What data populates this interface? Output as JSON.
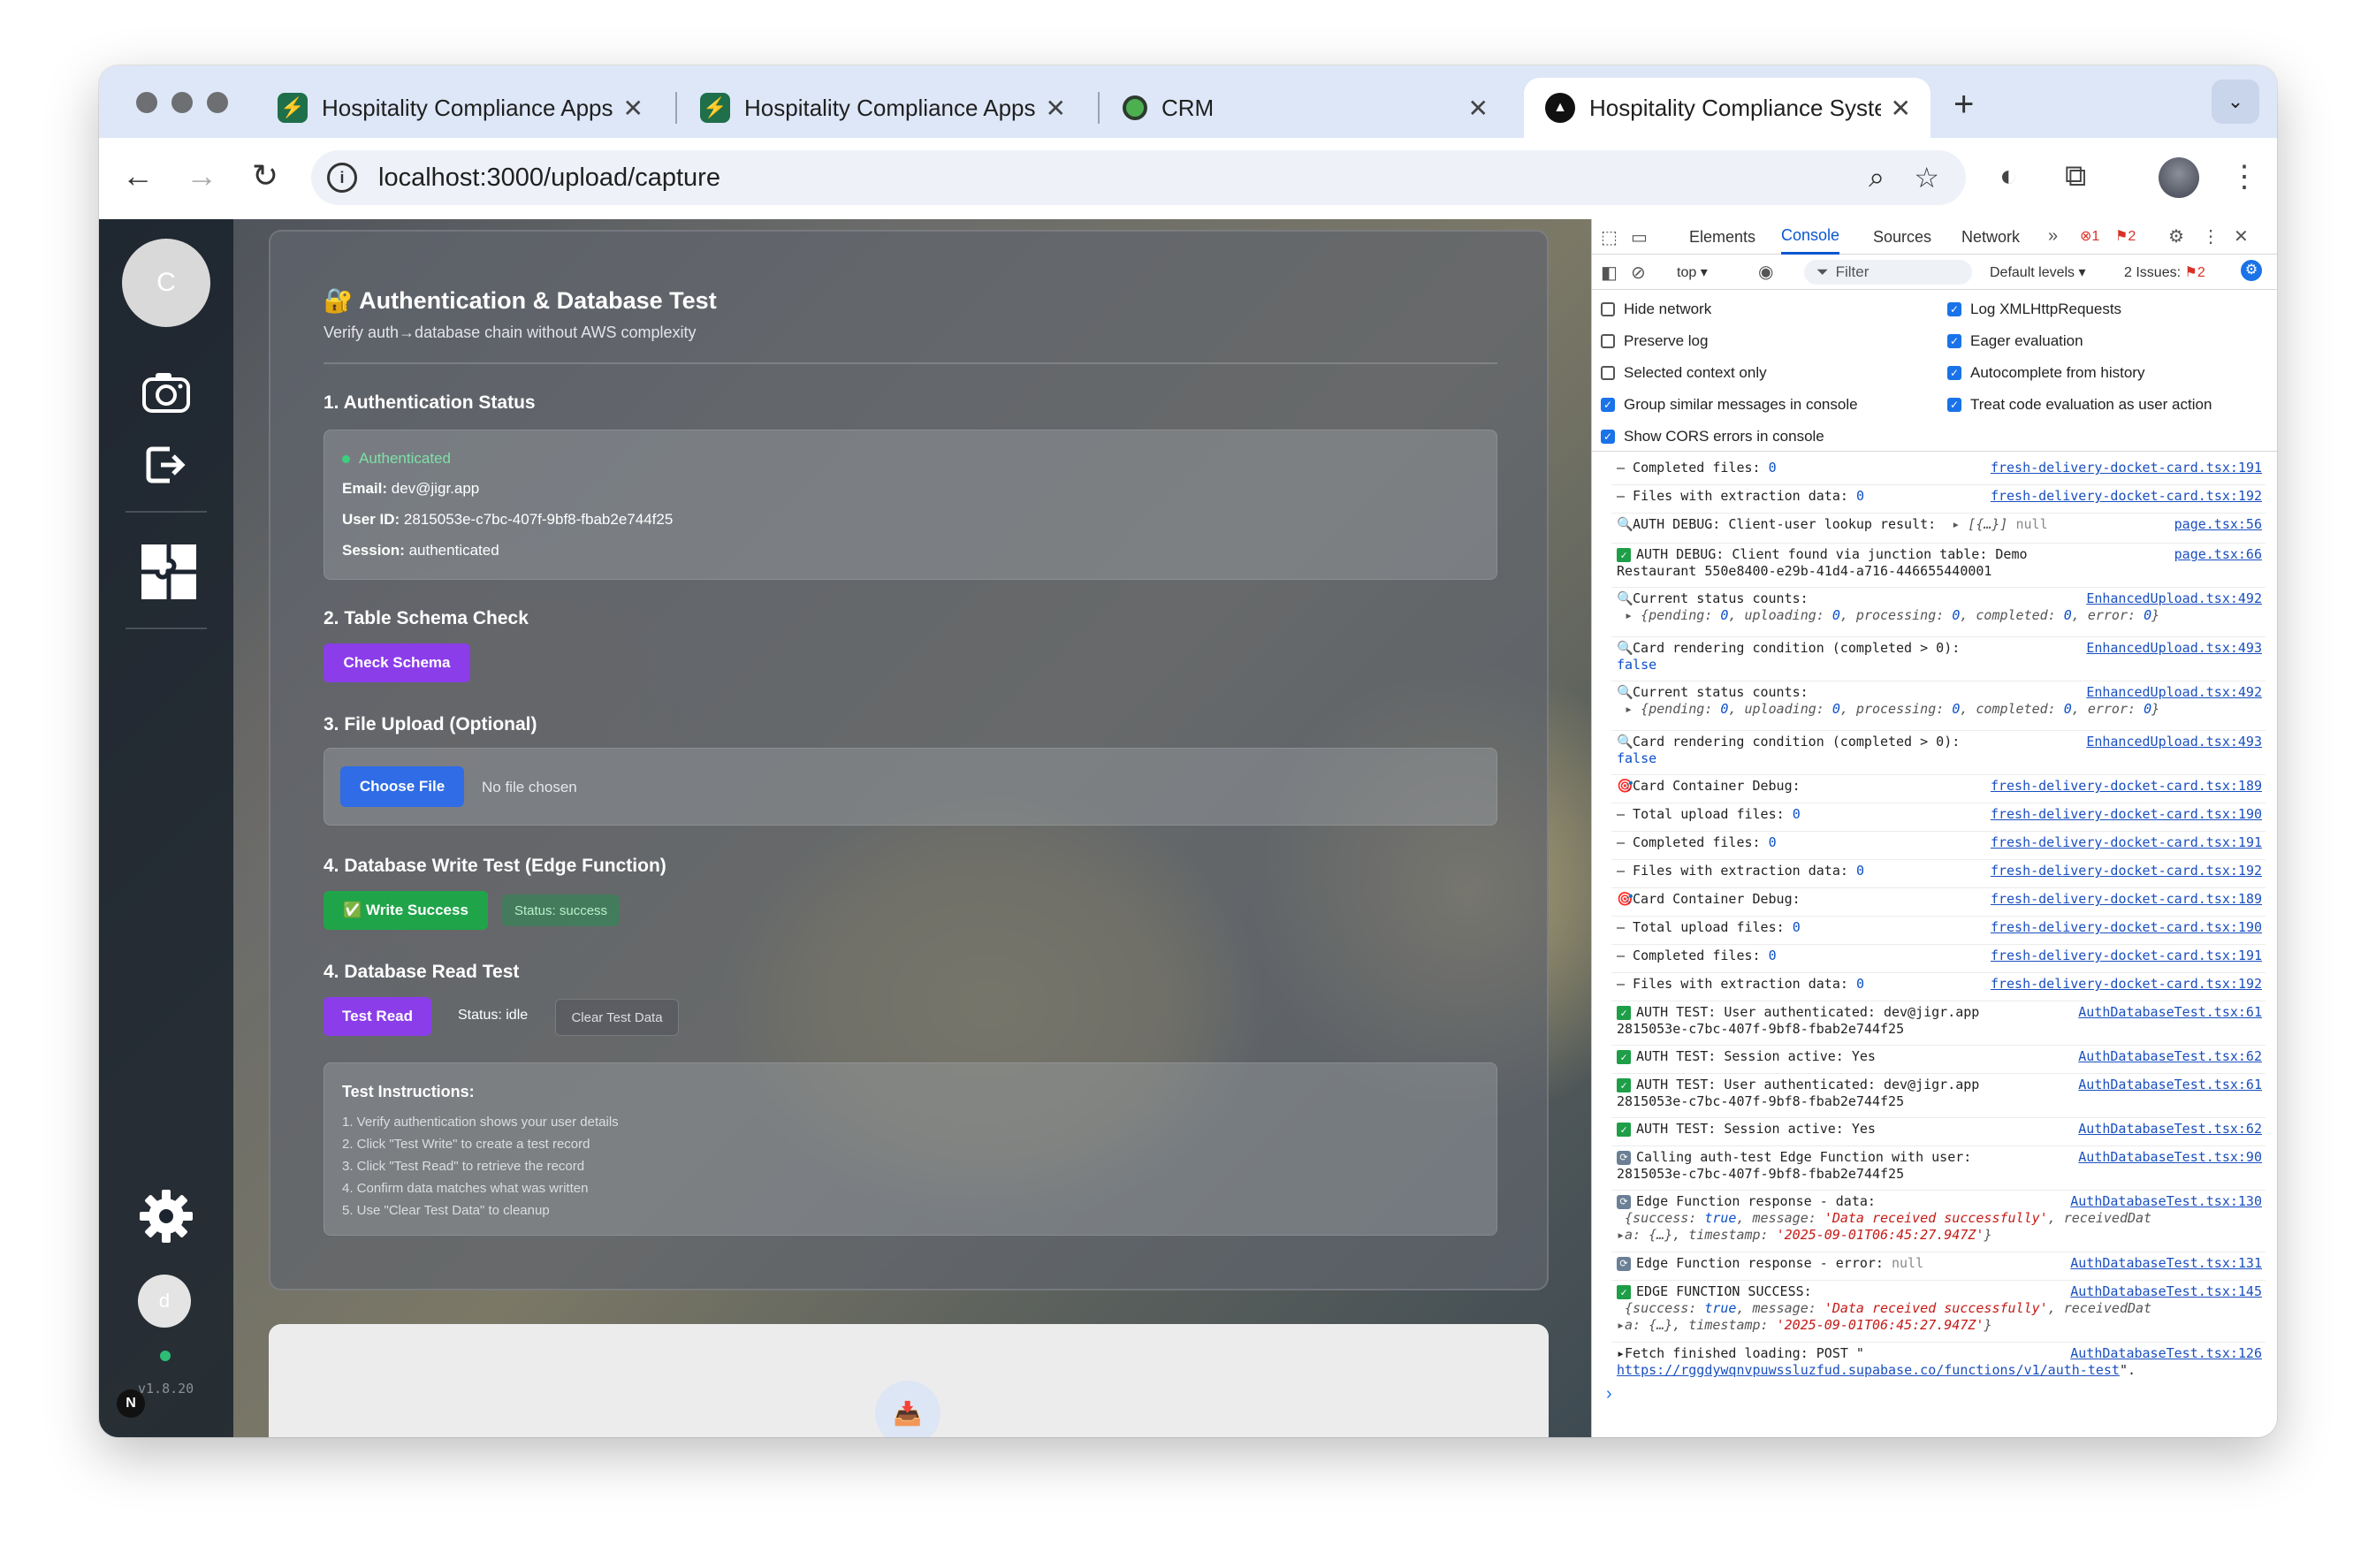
{
  "browser": {
    "tabs": [
      {
        "title": "Hospitality Compliance Apps",
        "favicon": "bolt-icon",
        "active": false
      },
      {
        "title": "Hospitality Compliance Apps",
        "favicon": "bolt-icon",
        "active": false
      },
      {
        "title": "CRM",
        "favicon": "circle-icon",
        "active": false
      },
      {
        "title": "Hospitality Compliance Syste",
        "favicon": "triangle-icon",
        "active": true
      }
    ],
    "close_glyph": "✕",
    "new_tab": "+",
    "url": "localhost:3000/upload/capture"
  },
  "sidebar": {
    "avatar_letter": "C",
    "user_letter": "d",
    "version": "v1.8.20",
    "next_badge": "N"
  },
  "panel": {
    "title": "🔐 Authentication & Database Test",
    "subtitle": "Verify auth→database chain without AWS complexity",
    "s1": "1. Authentication Status",
    "auth_status": "Authenticated",
    "email_label": "Email:",
    "email": "dev@jigr.app",
    "userid_label": "User ID:",
    "userid": "2815053e-c7bc-407f-9bf8-fbab2e744f25",
    "session_label": "Session:",
    "session": "authenticated",
    "s2": "2. Table Schema Check",
    "check_schema": "Check Schema",
    "s3": "3. File Upload (Optional)",
    "choose_file": "Choose File",
    "no_file": "No file chosen",
    "s4": "4. Database Write Test (Edge Function)",
    "write_success": "✅ Write Success",
    "write_status": "Status: success",
    "s5": "4. Database Read Test",
    "test_read": "Test Read",
    "read_status": "Status: idle",
    "clear_test": "Clear Test Data",
    "instr_title": "Test Instructions:",
    "instructions": [
      "1. Verify authentication shows your user details",
      "2. Click \"Test Write\" to create a test record",
      "3. Click \"Test Read\" to retrieve the record",
      "4. Confirm data matches what was written",
      "5. Use \"Clear Test Data\" to cleanup"
    ]
  },
  "devtools": {
    "tabs": [
      "Elements",
      "Console",
      "Sources",
      "Network"
    ],
    "active_tab": "Console",
    "error_count": "1",
    "warn_count": "2",
    "context": "top ▾",
    "filter": "Filter",
    "levels": "Default levels ▾",
    "issues_label": "2 Issues:",
    "issues_count": "2",
    "options_left": [
      "Hide network",
      "Preserve log",
      "Selected context only",
      "Group similar messages in console",
      "Show CORS errors in console"
    ],
    "options_left_checked": [
      false,
      false,
      false,
      true,
      true
    ],
    "options_right": [
      "Log XMLHttpRequests",
      "Eager evaluation",
      "Autocomplete from history",
      "Treat code evaluation as user action"
    ],
    "options_right_checked": [
      true,
      true,
      true,
      true
    ]
  }
}
